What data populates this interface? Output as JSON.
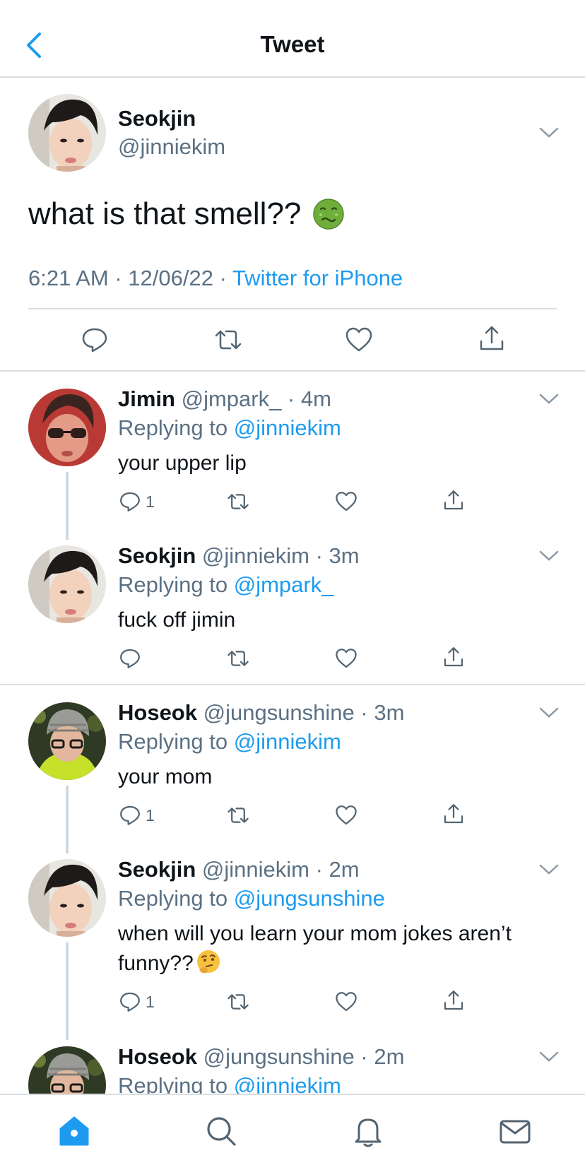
{
  "header": {
    "title": "Tweet"
  },
  "main_tweet": {
    "name": "Seokjin",
    "handle": "@jinniekim",
    "text": "what is that smell??",
    "time": "6:21 AM · 12/06/22 · ",
    "source": "Twitter for iPhone"
  },
  "replies": [
    {
      "name": "Jimin",
      "handle": "@jmpark_ · 4m",
      "replying_label": "Replying to ",
      "replying_to": "@jinniekim",
      "text": "your upper lip",
      "reply_count": "1"
    },
    {
      "name": "Seokjin",
      "handle": "@jinniekim · 3m",
      "replying_label": "Replying to ",
      "replying_to": "@jmpark_",
      "text": "fuck off jimin",
      "reply_count": ""
    },
    {
      "name": "Hoseok",
      "handle": "@jungsunshine · 3m",
      "replying_label": "Replying to ",
      "replying_to": "@jinniekim",
      "text": "your mom",
      "reply_count": "1"
    },
    {
      "name": "Seokjin",
      "handle": "@jinniekim · 2m",
      "replying_label": "Replying to ",
      "replying_to": "@jungsunshine",
      "text": "when will you learn your mom jokes aren’t funny??",
      "reply_count": "1"
    },
    {
      "name": "Hoseok",
      "handle": "@jungsunshine · 2m",
      "replying_label": "Replying to ",
      "replying_to": "@jinniekim",
      "text": "",
      "reply_count": ""
    }
  ],
  "icons": {
    "back": "chevron-left-icon",
    "more": "chevron-down-icon",
    "reply": "speech-bubble-icon",
    "retweet": "retweet-icon",
    "like": "heart-icon",
    "share": "share-icon",
    "home": "home-icon",
    "search": "search-icon",
    "notifications": "bell-icon",
    "messages": "envelope-icon"
  },
  "colors": {
    "accent": "#1d9bf0",
    "secondary_text": "#5b7083",
    "divider": "#d9dde1"
  }
}
